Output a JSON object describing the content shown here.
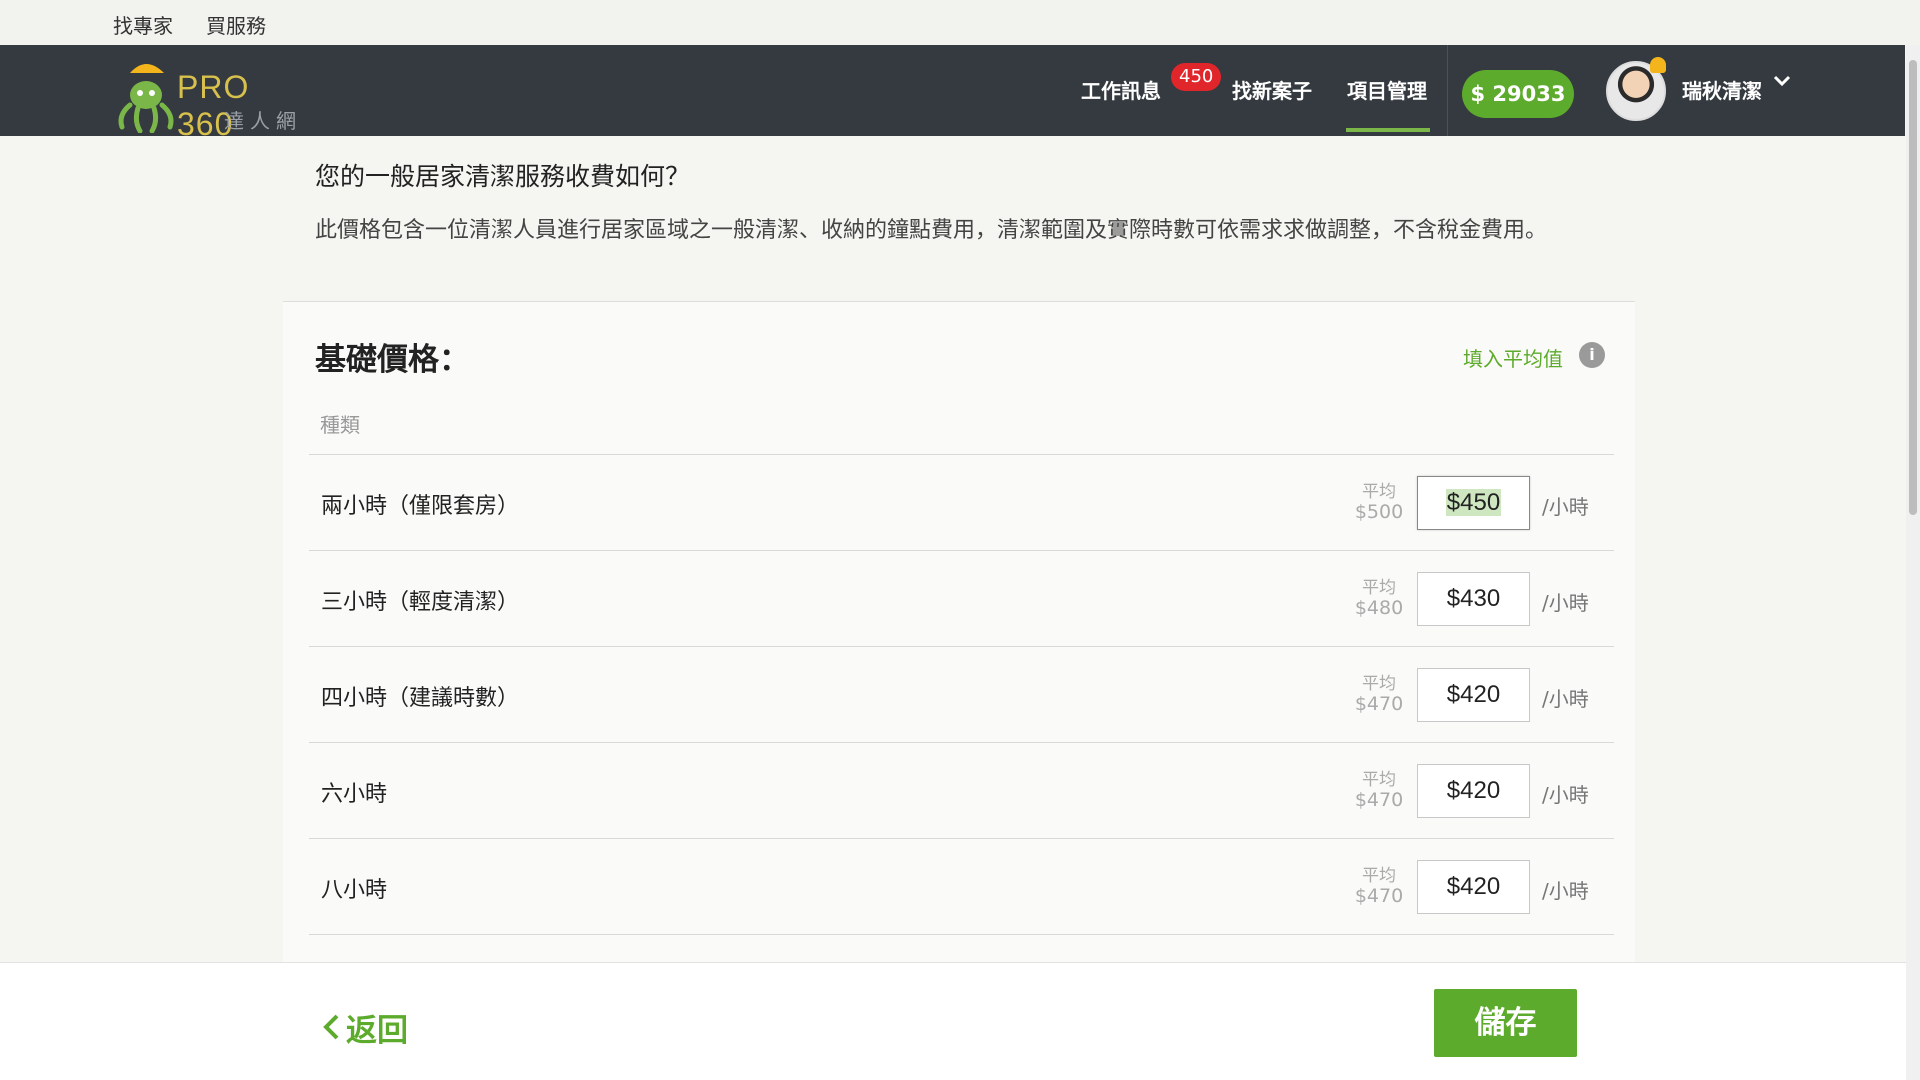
{
  "topbar": {
    "links": [
      "找專家",
      "買服務"
    ]
  },
  "brand": {
    "name": "PRO 360",
    "subtitle": "達人網"
  },
  "nav": {
    "items": [
      "工作訊息",
      "找新案子",
      "項目管理"
    ],
    "badge": "450",
    "active": "項目管理",
    "credit": "$ 29033",
    "user_name": "瑞秋清潔"
  },
  "page": {
    "question": "您的一般居家清潔服務收費如何？",
    "description": "此價格包含一位清潔人員進行居家區域之一般清潔、收納的鐘點費用，清潔範圍及實際時數可依需求求做調整，不含稅金費用。",
    "section_title": "基礎價格：",
    "fill_average": "填入平均值",
    "type_header": "種類",
    "avg_label": "平均",
    "unit": "/小時",
    "rows": [
      {
        "label": "兩小時（僅限套房）",
        "avg": "$500",
        "value": "$450"
      },
      {
        "label": "三小時（輕度清潔）",
        "avg": "$480",
        "value": "$430"
      },
      {
        "label": "四小時（建議時數）",
        "avg": "$470",
        "value": "$420"
      },
      {
        "label": "六小時",
        "avg": "$470",
        "value": "$420"
      },
      {
        "label": "八小時",
        "avg": "$470",
        "value": "$420"
      }
    ]
  },
  "footer": {
    "back": "返回",
    "save": "儲存"
  },
  "colors": {
    "accent": "#5dab2c",
    "nav_bg": "#343a40",
    "badge": "#e0262a"
  }
}
